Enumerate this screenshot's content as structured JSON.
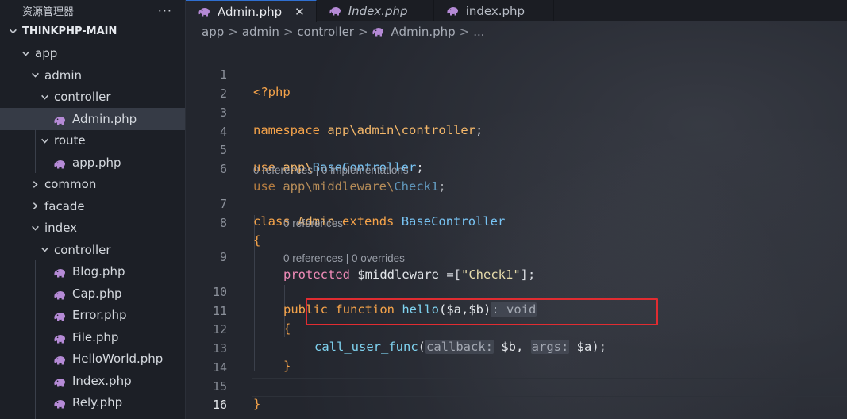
{
  "sidebar": {
    "title": "资源管理器",
    "more": "···",
    "items": [
      {
        "label": "THINKPHP-MAIN",
        "type": "root",
        "chevron": "down"
      },
      {
        "label": "app",
        "type": "folder",
        "chevron": "down"
      },
      {
        "label": "admin",
        "type": "folder",
        "chevron": "down"
      },
      {
        "label": "controller",
        "type": "folder",
        "chevron": "down"
      },
      {
        "label": "Admin.php",
        "type": "file",
        "selected": true
      },
      {
        "label": "route",
        "type": "folder",
        "chevron": "down"
      },
      {
        "label": "app.php",
        "type": "file"
      },
      {
        "label": "common",
        "type": "folder",
        "chevron": "right"
      },
      {
        "label": "facade",
        "type": "folder",
        "chevron": "right"
      },
      {
        "label": "index",
        "type": "folder",
        "chevron": "down"
      },
      {
        "label": "controller",
        "type": "folder",
        "chevron": "down"
      },
      {
        "label": "Blog.php",
        "type": "file"
      },
      {
        "label": "Cap.php",
        "type": "file"
      },
      {
        "label": "Error.php",
        "type": "file"
      },
      {
        "label": "File.php",
        "type": "file"
      },
      {
        "label": "HelloWorld.php",
        "type": "file"
      },
      {
        "label": "Index.php",
        "type": "file"
      },
      {
        "label": "Rely.php",
        "type": "file"
      }
    ]
  },
  "tabs": [
    {
      "label": "Admin.php",
      "active": true,
      "close": "✕",
      "italic": false
    },
    {
      "label": "Index.php",
      "active": false,
      "italic": true
    },
    {
      "label": "index.php",
      "active": false,
      "italic": false
    }
  ],
  "breadcrumb": {
    "parts": [
      "app",
      "admin",
      "controller",
      "Admin.php",
      "..."
    ],
    "separator": ">"
  },
  "editor": {
    "line_numbers": [
      "1",
      "2",
      "3",
      "4",
      "5",
      "6",
      "7",
      "8",
      "9",
      "10",
      "11",
      "12",
      "13",
      "14",
      "15",
      "16"
    ],
    "code": {
      "l1": "<?php",
      "l3_kw": "namespace",
      "l3_ns": "app\\admin\\controller",
      "l3_end": ";",
      "l5_kw": "use",
      "l5_ns": "app\\",
      "l5_cls": "BaseController",
      "l5_end": ";",
      "l6_kw": "use",
      "l6_ns": "app\\middleware\\",
      "l6_cls": "Check1",
      "l6_end": ";",
      "lens_class": "0 references | 0 implementations",
      "l7_kw": "class",
      "l7_name": "Admin",
      "l7_kw2": "extends",
      "l7_parent": "BaseController",
      "l8": "{",
      "lens_prop": "0 references",
      "l9_kw": "protected",
      "l9_var": "$middleware",
      "l9_eq": " =[",
      "l9_str": "\"Check1\"",
      "l9_end": "];",
      "lens_method": "0 references | 0 overrides",
      "l10_kw": "public",
      "l10_kw2": "function",
      "l10_fn": "hello",
      "l10_params": "($a,$b)",
      "l10_hint": ": void",
      "l11": "{",
      "l12_fn": "call_user_func",
      "l12_open": "(",
      "l12_hint1": "callback:",
      "l12_arg1": " $b, ",
      "l12_hint2": "args:",
      "l12_arg2": " $a",
      "l12_end": ");",
      "l13": "}",
      "l15": "}"
    },
    "current_line": "16",
    "highlight_color": "#e12c31"
  },
  "colors": {
    "keyword": "#f5a34a",
    "class": "#78c4f4",
    "function": "#7fd3f0",
    "string": "#e6dbab",
    "tab_accent": "#2f6fd0"
  },
  "icons": {
    "php_file": "php-elephant-icon",
    "chevron_down": "chevron-down-icon",
    "chevron_right": "chevron-right-icon",
    "close": "close-icon",
    "more": "more-icon"
  }
}
